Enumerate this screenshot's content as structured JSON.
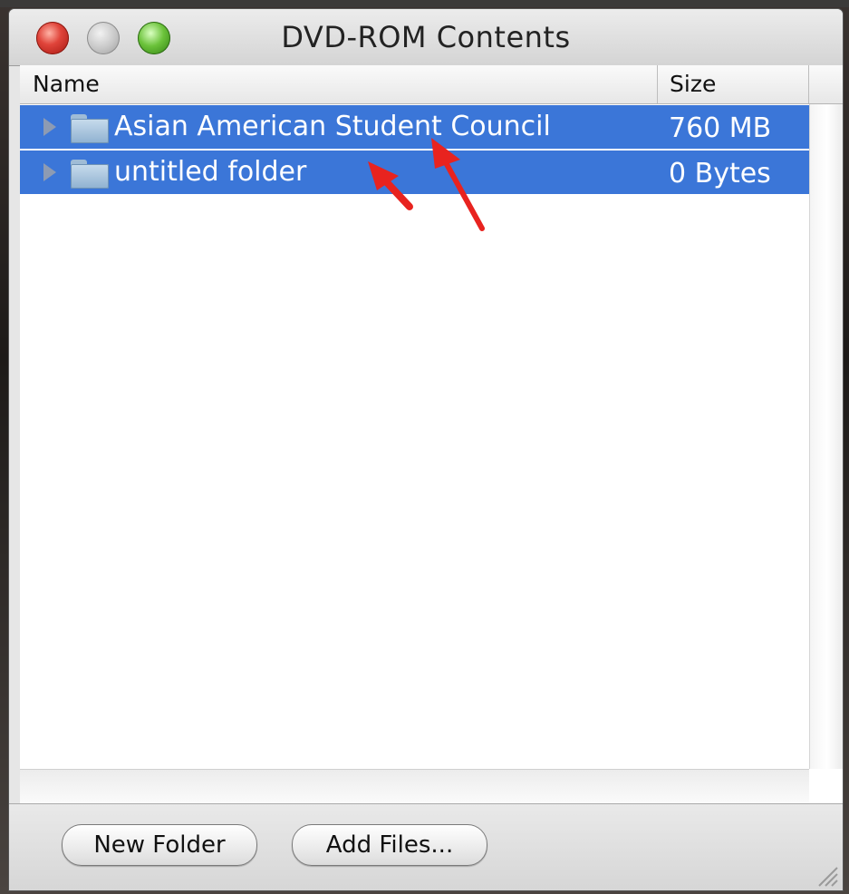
{
  "window": {
    "title": "DVD-ROM Contents"
  },
  "columns": {
    "name": "Name",
    "size": "Size"
  },
  "rows": [
    {
      "name": "Asian American Student Council",
      "size": "760 MB"
    },
    {
      "name": "untitled folder",
      "size": "0 Bytes"
    }
  ],
  "buttons": {
    "new_folder": "New Folder",
    "add_files": "Add Files..."
  },
  "colors": {
    "selection": "#3b76d8",
    "annotation_arrow": "#e8231f"
  }
}
